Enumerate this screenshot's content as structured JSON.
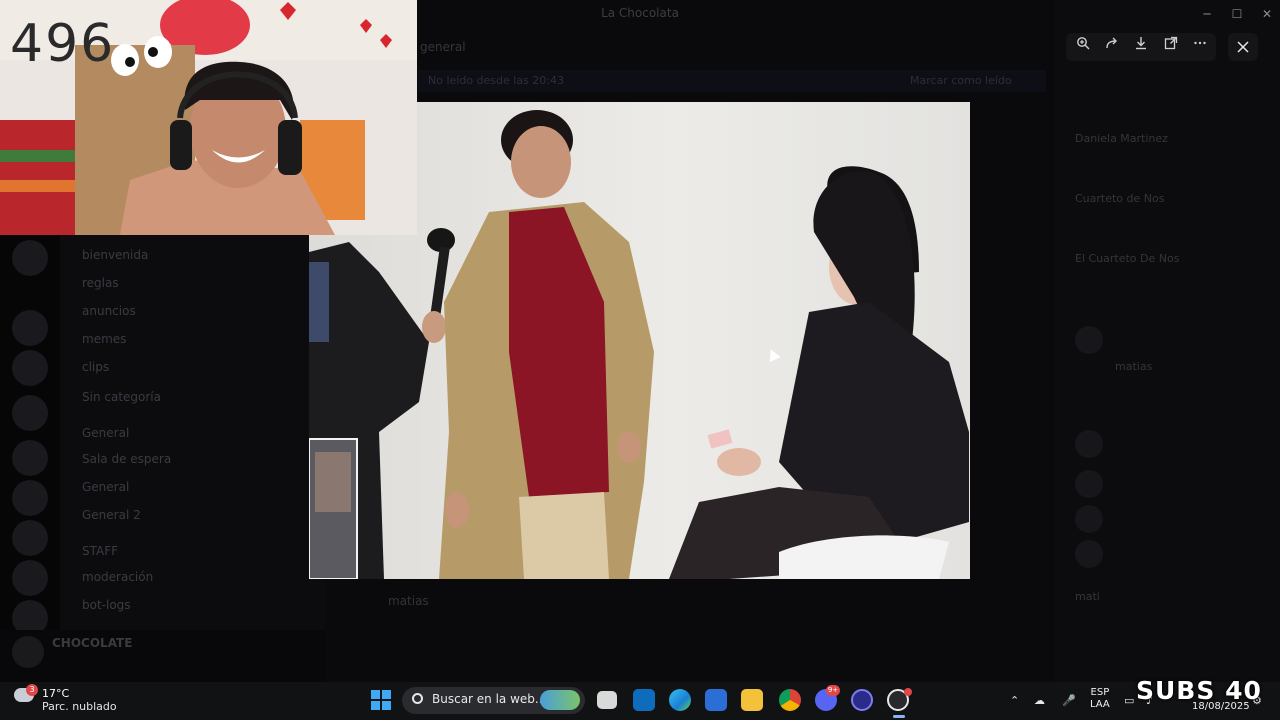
{
  "window": {
    "title": "La Chocolata",
    "channel_title": "general",
    "notice_text": "No leído desde las 20:43",
    "notice_action": "Marcar como leído",
    "controls": {
      "minimize": "─",
      "maximize": "☐",
      "close": "✕"
    }
  },
  "channels": [
    {
      "name": "bienvenida"
    },
    {
      "name": "reglas"
    },
    {
      "name": "anuncios"
    },
    {
      "name": "memes"
    },
    {
      "name": "clips"
    },
    {
      "name": "Sin categoría"
    },
    {
      "name": "General"
    },
    {
      "name": "Sala de espera"
    },
    {
      "name": "General"
    },
    {
      "name": "General 2"
    },
    {
      "name": "STAFF"
    },
    {
      "name": "moderación"
    },
    {
      "name": "bot-logs"
    }
  ],
  "members": [
    {
      "name": "Daniela Martinez"
    },
    {
      "name": "Cuarteto de Nos"
    },
    {
      "name": "El Cuarteto De Nos"
    },
    {
      "name": "matias"
    },
    {
      "name": "mati"
    }
  ],
  "chat": {
    "last_author": "matias"
  },
  "user_panel": {
    "name": "CHOCOLATE"
  },
  "viewer": {
    "zoom_icon": "zoom-in-icon",
    "forward_icon": "forward-icon",
    "download_icon": "download-icon",
    "open_icon": "open-external-icon",
    "more_icon": "more-icon",
    "close_icon": "close-icon"
  },
  "stream_overlay": {
    "counter": "496",
    "subs": "SUBS 40"
  },
  "taskbar": {
    "weather_temp": "17°C",
    "weather_desc": "Parc. nublado",
    "weather_badge": "3",
    "search_placeholder": "Buscar en la web...",
    "lang_top": "ESP",
    "lang_bottom": "LAA",
    "date": "18/08/2025",
    "discord_badge": "9+"
  },
  "colors": {
    "taskbar_bg": "#111214",
    "viewer_toolbar_bg": "#151517",
    "accent_blue": "#0078d4"
  }
}
